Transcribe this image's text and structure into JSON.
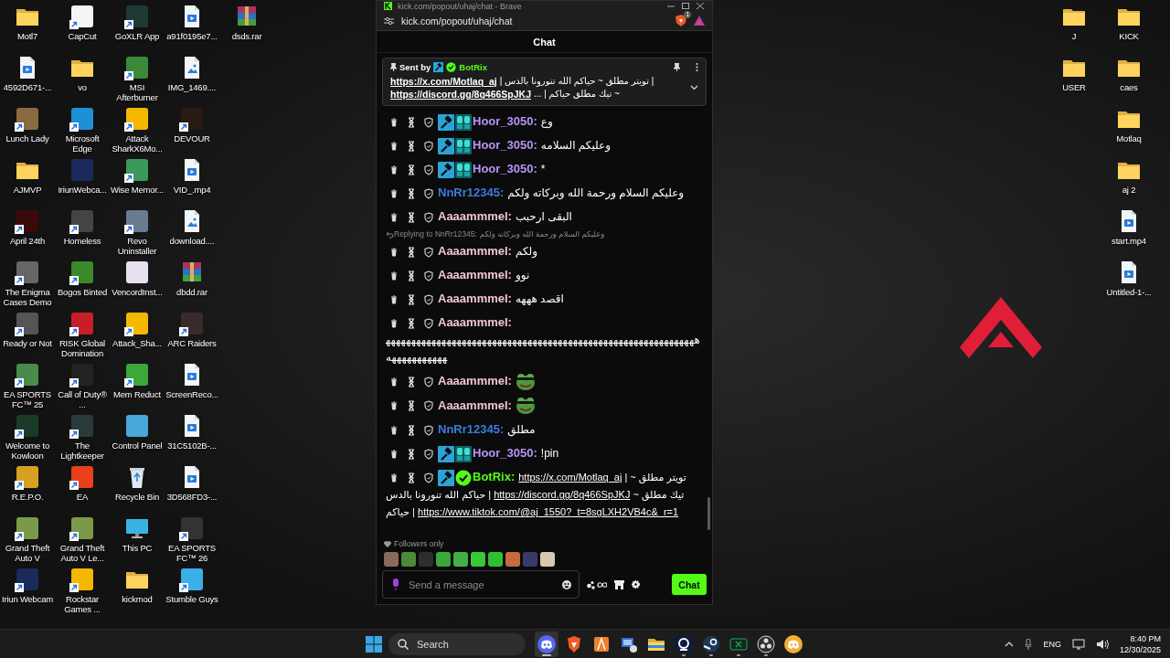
{
  "desktop_left": {
    "columns": [
      [
        {
          "label": "Motl7",
          "kind": "folder",
          "shortcut": false
        },
        {
          "label": "4592D671-...",
          "kind": "video",
          "shortcut": false
        },
        {
          "label": "Lunch Lady",
          "kind": "app",
          "color": "#8a6a40",
          "shortcut": true
        },
        {
          "label": "AJMVP",
          "kind": "folder",
          "shortcut": false
        },
        {
          "label": "April 24th",
          "kind": "app",
          "color": "#3a0a0a",
          "shortcut": true
        },
        {
          "label": "The Enigma Cases Demo",
          "kind": "app",
          "color": "#666666",
          "shortcut": true
        },
        {
          "label": "Ready or Not",
          "kind": "app",
          "color": "#555555",
          "shortcut": true
        },
        {
          "label": "EA SPORTS FC™ 25",
          "kind": "app",
          "color": "#4a8a4a",
          "shortcut": true
        },
        {
          "label": "Welcome to Kowloon",
          "kind": "app",
          "color": "#1a3a2a",
          "shortcut": true
        },
        {
          "label": "R.E.P.O.",
          "kind": "app",
          "color": "#d8a020",
          "shortcut": true
        },
        {
          "label": "Grand Theft Auto V",
          "kind": "app",
          "color": "#7a9a4a",
          "shortcut": true
        },
        {
          "label": "Iriun Webcam",
          "kind": "app",
          "color": "#1a2a5a",
          "shortcut": true
        }
      ],
      [
        {
          "label": "CapCut",
          "kind": "app",
          "color": "#f5f5f5",
          "shortcut": true
        },
        {
          "label": "vo",
          "kind": "folder",
          "shortcut": false
        },
        {
          "label": "Microsoft Edge",
          "kind": "app",
          "color": "#1e90d8",
          "shortcut": true
        },
        {
          "label": "IriunWebca...",
          "kind": "app",
          "color": "#1a2a5a",
          "shortcut": false
        },
        {
          "label": "Homeless",
          "kind": "app",
          "color": "#444444",
          "shortcut": true
        },
        {
          "label": "Bogos Binted",
          "kind": "app",
          "color": "#3a8a2a",
          "shortcut": true
        },
        {
          "label": "RISK Global Domination",
          "kind": "app",
          "color": "#c81e2a",
          "shortcut": true
        },
        {
          "label": "Call of Duty® ...",
          "kind": "app",
          "color": "#222222",
          "shortcut": true
        },
        {
          "label": "The Lightkeeper",
          "kind": "app",
          "color": "#2a3a3a",
          "shortcut": true
        },
        {
          "label": "EA",
          "kind": "app",
          "color": "#e8401a",
          "shortcut": true
        },
        {
          "label": "Grand Theft Auto V Le...",
          "kind": "app",
          "color": "#7a9a4a",
          "shortcut": true
        },
        {
          "label": "Rockstar Games ...",
          "kind": "app",
          "color": "#f5b800",
          "shortcut": true
        }
      ],
      [
        {
          "label": "GoXLR App",
          "kind": "app",
          "color": "#1f3a34",
          "shortcut": true
        },
        {
          "label": "MSI Afterburner",
          "kind": "app",
          "color": "#3a8a3a",
          "shortcut": true
        },
        {
          "label": "Attack SharkX6Mo...",
          "kind": "app",
          "color": "#f5b800",
          "shortcut": true
        },
        {
          "label": "Wise Memor...",
          "kind": "app",
          "color": "#3a9a5a",
          "shortcut": true
        },
        {
          "label": "Revo Uninstaller",
          "kind": "app",
          "color": "#6a7a90",
          "shortcut": true
        },
        {
          "label": "VencordInst...",
          "kind": "app",
          "color": "#e8e0f0",
          "shortcut": false
        },
        {
          "label": "Attack_Sha...",
          "kind": "app",
          "color": "#f5b800",
          "shortcut": true
        },
        {
          "label": "Mem Reduct",
          "kind": "app",
          "color": "#3aa83a",
          "shortcut": true
        },
        {
          "label": "Control Panel",
          "kind": "app",
          "color": "#4aa8d8",
          "shortcut": false
        },
        {
          "label": "Recycle Bin",
          "kind": "recycle",
          "shortcut": false
        },
        {
          "label": "This PC",
          "kind": "monitor",
          "shortcut": false
        },
        {
          "label": "kickmod",
          "kind": "folder",
          "shortcut": false
        }
      ],
      [
        {
          "label": "a91f0195e7...",
          "kind": "video",
          "shortcut": false
        },
        {
          "label": "IMG_1469....",
          "kind": "image",
          "shortcut": false
        },
        {
          "label": "DEVOUR",
          "kind": "app",
          "color": "#2a1a14",
          "shortcut": true
        },
        {
          "label": "VID_.mp4",
          "kind": "video",
          "shortcut": false
        },
        {
          "label": "download....",
          "kind": "image",
          "shortcut": false
        },
        {
          "label": "dbdd.rar",
          "kind": "archive",
          "shortcut": false
        },
        {
          "label": "ARC Raiders",
          "kind": "app",
          "color": "#3a2a2a",
          "shortcut": true
        },
        {
          "label": "ScreenReco...",
          "kind": "video",
          "shortcut": false
        },
        {
          "label": "31C5102B-...",
          "kind": "video",
          "shortcut": false
        },
        {
          "label": "3D568FD3-...",
          "kind": "video",
          "shortcut": false
        },
        {
          "label": "EA SPORTS FC™ 26",
          "kind": "app",
          "color": "#333333",
          "shortcut": true
        },
        {
          "label": "Stumble Guys",
          "kind": "app",
          "color": "#3ab0e8",
          "shortcut": true
        }
      ],
      [
        {
          "label": "dsds.rar",
          "kind": "archive",
          "shortcut": false
        }
      ]
    ]
  },
  "desktop_right": {
    "columns": [
      [
        {
          "label": "J",
          "kind": "folder",
          "shortcut": false
        },
        {
          "label": "USER",
          "kind": "folder",
          "shortcut": false
        }
      ],
      [
        {
          "label": "KICK",
          "kind": "folder",
          "shortcut": false
        },
        {
          "label": "caes",
          "kind": "folder",
          "shortcut": false
        },
        {
          "label": "Motlaq",
          "kind": "folder",
          "shortcut": false
        },
        {
          "label": "aj 2",
          "kind": "folder",
          "shortcut": false
        },
        {
          "label": "start.mp4",
          "kind": "video",
          "shortcut": false
        },
        {
          "label": "Untitled-1-...",
          "kind": "video",
          "shortcut": false
        }
      ]
    ]
  },
  "browser": {
    "title": "kick.com/popout/uhaj/chat - Brave",
    "url": "kick.com/popout/uhaj/chat",
    "shield_count": "1"
  },
  "chat": {
    "title": "Chat",
    "pinned": {
      "label": "Sent by",
      "username": "BotRix",
      "color": "#53fc18",
      "badges": [
        {
          "kind": "moderator"
        },
        {
          "kind": "verified"
        }
      ],
      "lines": [
        [
          {
            "kind": "link",
            "text": "https://x.com/Motlaq_aj"
          },
          {
            "kind": "text",
            "text": "| تويتر مطلق ~ حياكم الله تنورونا بالدس |"
          }
        ],
        [
          {
            "kind": "link",
            "text": "https://discord.gg/8q466SpJKJ"
          },
          {
            "kind": "text",
            "text": "~ تيك مطلق حياكم | ..."
          }
        ]
      ]
    },
    "messages": [
      {
        "kind": "text",
        "username": "Hoor_3050:",
        "color": "#b794f4",
        "badges": [
          {
            "kind": "moderator"
          },
          {
            "kind": "og"
          }
        ],
        "text": "وع"
      },
      {
        "kind": "text",
        "username": "Hoor_3050:",
        "color": "#b794f4",
        "badges": [
          {
            "kind": "moderator"
          },
          {
            "kind": "og"
          }
        ],
        "text": "وعليكم السلامه"
      },
      {
        "kind": "text",
        "username": "Hoor_3050:",
        "color": "#b794f4",
        "badges": [
          {
            "kind": "moderator"
          },
          {
            "kind": "og"
          }
        ],
        "text": "*"
      },
      {
        "kind": "text",
        "username": "NnRr12345:",
        "color": "#3b7ddd",
        "text": "وعليكم السلام ورحمة الله وبركاته ولكم"
      },
      {
        "kind": "text",
        "username": "Aaaammmel:",
        "color": "#f2c4d6",
        "text": "البقى ارحبب"
      },
      {
        "kind": "reply",
        "label": "Replying to NnRr12345:",
        "quote": "وعليكم السلام ورحمة الله وبركاته ولكم"
      },
      {
        "kind": "text",
        "username": "Aaaammmel:",
        "color": "#f2c4d6",
        "text": "ولكم"
      },
      {
        "kind": "text",
        "username": "Aaaammmel:",
        "color": "#f2c4d6",
        "text": "نوو"
      },
      {
        "kind": "text",
        "username": "Aaaammmel:",
        "color": "#f2c4d6",
        "text": "اقصد هههه"
      },
      {
        "kind": "text",
        "username": "Aaaammmel:",
        "color": "#f2c4d6",
        "text": "هههههههههههههههههههههههههههههههههههههههههههههههههههههههههههههههههههههههههه"
      },
      {
        "kind": "emote",
        "username": "Aaaammmel:",
        "color": "#f2c4d6"
      },
      {
        "kind": "emote",
        "username": "Aaaammmel:",
        "color": "#f2c4d6"
      },
      {
        "kind": "text",
        "username": "NnRr12345:",
        "color": "#3b7ddd",
        "text": "مطلق"
      },
      {
        "kind": "text",
        "username": "Hoor_3050:",
        "color": "#b794f4",
        "badges": [
          {
            "kind": "moderator"
          },
          {
            "kind": "og"
          }
        ],
        "text": "!pin"
      },
      {
        "kind": "parts",
        "username": "BotRix:",
        "color": "#53fc18",
        "badges": [
          {
            "kind": "moderator"
          },
          {
            "kind": "verified"
          }
        ],
        "parts": [
          {
            "kind": "text",
            "text": "تويتر مطلق ~ |"
          },
          {
            "kind": "link",
            "text": "https://x.com/Motlaq_aj"
          },
          {
            "kind": "text",
            "text": "تيك مطلق ~"
          },
          {
            "kind": "link",
            "text": "https://discord.gg/8q466SpJKJ"
          },
          {
            "kind": "text",
            "text": "| حياكم الله تنورونا بالدس"
          },
          {
            "kind": "link",
            "text": "https://www.tiktok.com/@aj_1550?_t=8sgLXH2VB4c&_r=1"
          },
          {
            "kind": "text",
            "text": "| حياكم"
          }
        ]
      }
    ],
    "mode": "Followers only",
    "emotes": [
      {
        "color": "#8a6a5a"
      },
      {
        "color": "#4a8a3a"
      },
      {
        "color": "#2e2e2e"
      },
      {
        "color": "#3aa83a"
      },
      {
        "color": "#44b044"
      },
      {
        "color": "#38c838"
      },
      {
        "color": "#30bf30"
      },
      {
        "color": "#c86a3a"
      },
      {
        "color": "#3a3a6a"
      },
      {
        "color": "#d8c8b0"
      }
    ],
    "input": {
      "placeholder": "Send a message"
    },
    "send_button": "Chat"
  },
  "taskbar": {
    "search": {
      "placeholder": "Search"
    },
    "apps": [
      {
        "kind": "discord",
        "running": true,
        "selected": true
      },
      {
        "kind": "brave",
        "running": false,
        "selected": false
      },
      {
        "kind": "orange",
        "running": false,
        "selected": false
      },
      {
        "kind": "remote",
        "running": false,
        "selected": false
      },
      {
        "kind": "explorer",
        "running": false,
        "selected": false
      },
      {
        "kind": "webcam",
        "running": true,
        "selected": false
      },
      {
        "kind": "steam",
        "running": true,
        "selected": false
      },
      {
        "kind": "xbox",
        "running": true,
        "selected": false
      },
      {
        "kind": "obs",
        "running": true,
        "selected": false
      },
      {
        "kind": "yellow",
        "running": false,
        "selected": false
      }
    ],
    "tray": {
      "language": "ENG",
      "time": "8:40 PM",
      "date": "12/30/2025"
    }
  }
}
